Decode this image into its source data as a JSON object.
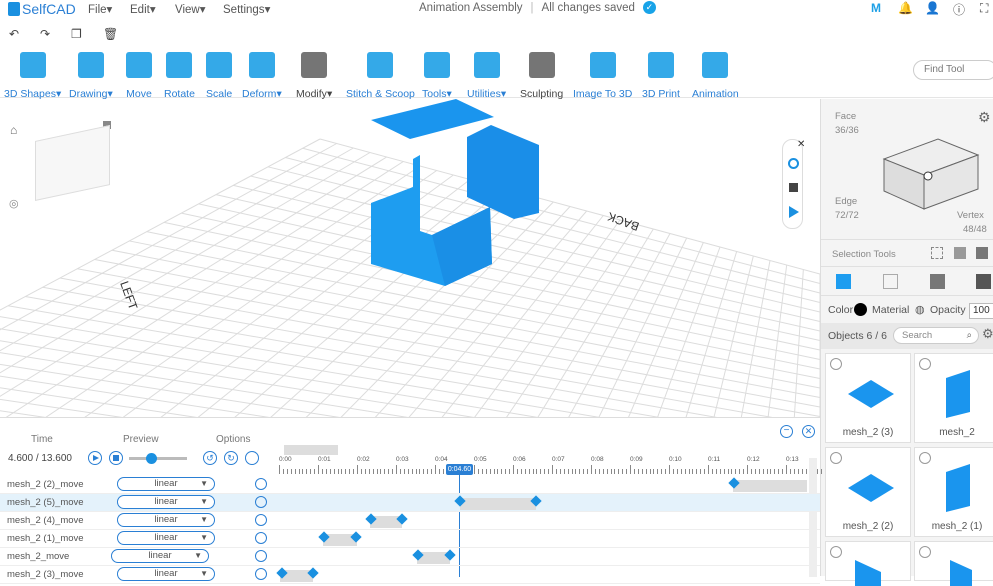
{
  "app": {
    "name": "SelfCAD"
  },
  "menu": [
    "File",
    "Edit",
    "View",
    "Settings"
  ],
  "document": {
    "title": "Animation Assembly",
    "save_status": "All changes saved"
  },
  "toolbar": [
    {
      "label": "3D Shapes",
      "dropdown": true
    },
    {
      "label": "Drawing",
      "dropdown": true
    },
    {
      "label": "Move",
      "dropdown": false
    },
    {
      "label": "Rotate",
      "dropdown": false
    },
    {
      "label": "Scale",
      "dropdown": false
    },
    {
      "label": "Deform",
      "dropdown": true
    },
    {
      "label": "Modify",
      "dropdown": true
    },
    {
      "label": "Stitch & Scoop",
      "dropdown": false
    },
    {
      "label": "Tools",
      "dropdown": true
    },
    {
      "label": "Utilities",
      "dropdown": true
    },
    {
      "label": "Sculpting",
      "dropdown": false
    },
    {
      "label": "Image To 3D",
      "dropdown": false
    },
    {
      "label": "3D Print",
      "dropdown": false
    },
    {
      "label": "Animation",
      "dropdown": false
    }
  ],
  "find_tool": {
    "placeholder": "Find Tool"
  },
  "viewport": {
    "label_left": "LEFT",
    "label_back": "BACK"
  },
  "selection_panel": {
    "face_label": "Face",
    "face_count": "36/36",
    "edge_label": "Edge",
    "edge_count": "72/72",
    "vertex_label": "Vertex",
    "vertex_count": "48/48",
    "selection_tools": "Selection Tools",
    "color_label": "Color",
    "material_label": "Material",
    "opacity_label": "Opacity",
    "opacity_value": "100",
    "objects_label": "Objects 6 / 6",
    "search_placeholder": "Search"
  },
  "objects": [
    {
      "name": "mesh_2 (3)"
    },
    {
      "name": "mesh_2"
    },
    {
      "name": "mesh_2 (2)"
    },
    {
      "name": "mesh_2 (1)"
    }
  ],
  "timeline": {
    "time_label": "Time",
    "preview_label": "Preview",
    "options_label": "Options",
    "current_time": "4.600",
    "total_time": "/ 13.600",
    "playhead_label": "0:04.60",
    "ticks": [
      "0:00",
      "0:01",
      "0:02",
      "0:03",
      "0:04",
      "0:05",
      "0:06",
      "0:07",
      "0:08",
      "0:09",
      "0:10",
      "0:11",
      "0:12",
      "0:13"
    ],
    "tracks": [
      {
        "name": "mesh_2 (2)_move",
        "easing": "linear",
        "selected": false
      },
      {
        "name": "mesh_2 (5)_move",
        "easing": "linear",
        "selected": true
      },
      {
        "name": "mesh_2 (4)_move",
        "easing": "linear",
        "selected": false
      },
      {
        "name": "mesh_2 (1)_move",
        "easing": "linear",
        "selected": false
      },
      {
        "name": "mesh_2_move",
        "easing": "linear",
        "selected": false
      },
      {
        "name": "mesh_2 (3)_move",
        "easing": "linear",
        "selected": false
      }
    ]
  },
  "colors": {
    "accent": "#1a90e0",
    "brand": "#2a7fd4",
    "object": "#1ea0f0"
  }
}
